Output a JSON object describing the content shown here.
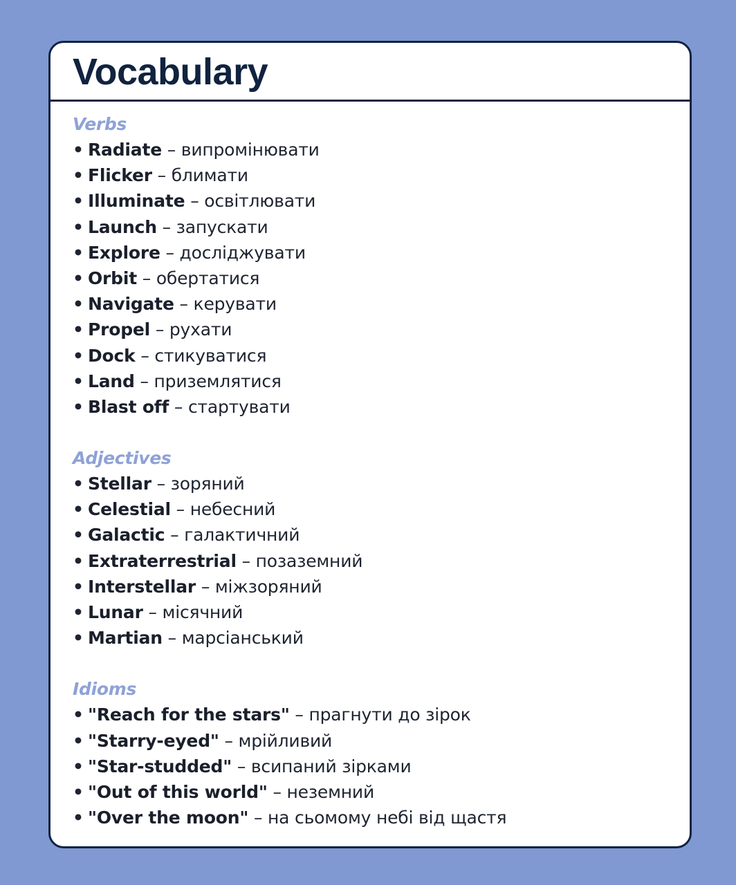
{
  "title": "Vocabulary",
  "sections": {
    "verbs": {
      "label": "Verbs",
      "items": [
        {
          "term": "Radiate",
          "translation": "випромінювати"
        },
        {
          "term": "Flicker",
          "translation": "блимати"
        },
        {
          "term": "Illuminate",
          "translation": "освітлювати"
        },
        {
          "term": "Launch",
          "translation": "запускати"
        },
        {
          "term": "Explore",
          "translation": "досліджувати"
        },
        {
          "term": "Orbit",
          "translation": "обертатися"
        },
        {
          "term": "Navigate",
          "translation": "керувати"
        },
        {
          "term": "Propel",
          "translation": "рухати"
        },
        {
          "term": "Dock",
          "translation": "стикуватися"
        },
        {
          "term": "Land",
          "translation": "приземлятися"
        },
        {
          "term": "Blast off",
          "translation": "стартувати"
        }
      ]
    },
    "adjectives": {
      "label": "Adjectives",
      "items": [
        {
          "term": "Stellar",
          "translation": "зоряний"
        },
        {
          "term": "Celestial",
          "translation": "небесний"
        },
        {
          "term": "Galactic",
          "translation": "галактичний"
        },
        {
          "term": "Extraterrestrial",
          "translation": "позаземний"
        },
        {
          "term": "Interstellar",
          "translation": "міжзоряний"
        },
        {
          "term": "Lunar",
          "translation": "місячний"
        },
        {
          "term": "Martian",
          "translation": "марсіанський"
        }
      ]
    },
    "idioms": {
      "label": "Idioms",
      "items": [
        {
          "term": "\"Reach for the stars\"",
          "translation": "прагнути до зірок"
        },
        {
          "term": "\"Starry-eyed\"",
          "translation": "мрійливий"
        },
        {
          "term": "\"Star-studded\"",
          "translation": "всипаний зірками"
        },
        {
          "term": "\"Out of this world\"",
          "translation": "неземний"
        },
        {
          "term": "\"Over the moon\"",
          "translation": "на сьомому небі від щастя"
        }
      ]
    }
  },
  "bullet": "•",
  "separator": "–",
  "colors": {
    "background": "#8099d3",
    "card": "#ffffff",
    "border": "#10233f",
    "title": "#10233f",
    "section_label": "#8ea2d6",
    "text": "#1e2430"
  }
}
